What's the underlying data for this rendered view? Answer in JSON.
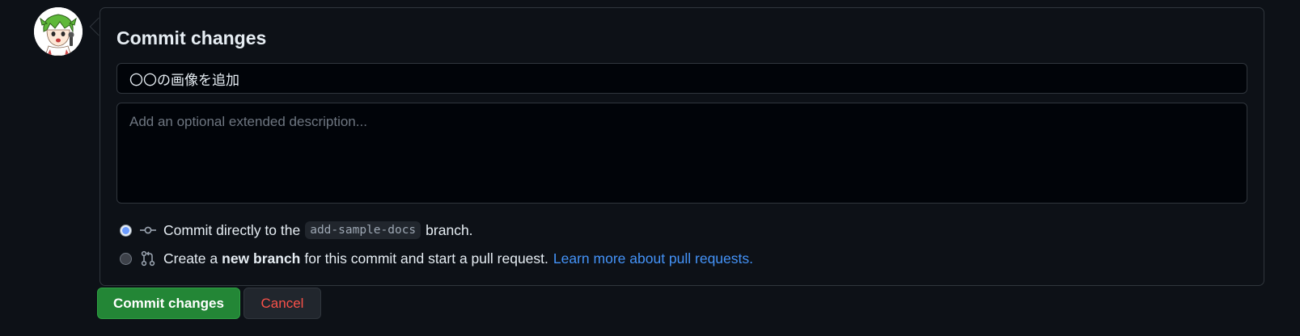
{
  "avatar": {
    "icon": "avatar-anime-character-icon"
  },
  "commit_form": {
    "title": "Commit changes",
    "summary_value": "〇〇の画像を追加",
    "description_placeholder": "Add an optional extended description...",
    "options": [
      {
        "selected": true,
        "icon": "git-commit-icon",
        "prefix": "Commit directly to the",
        "branch": "add-sample-docs",
        "suffix": "branch."
      },
      {
        "selected": false,
        "icon": "git-pull-request-icon",
        "prefix": "Create a",
        "bold": "new branch",
        "middle": "for this commit and start a pull request.",
        "link": "Learn more about pull requests."
      }
    ]
  },
  "buttons": {
    "commit_label": "Commit changes",
    "cancel_label": "Cancel"
  },
  "colors": {
    "background": "#0d1117",
    "primary_button": "#238636",
    "cancel_text": "#f85149",
    "link": "#4493f8",
    "radio_selected": "#6c9cff"
  }
}
